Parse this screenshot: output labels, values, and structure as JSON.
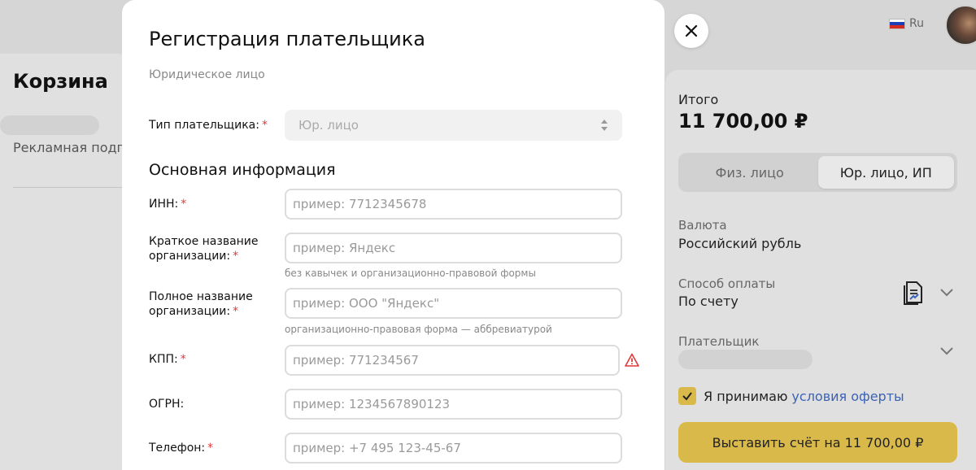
{
  "background": {
    "cart_title": "Корзина",
    "subscription_text": "Рекламная подпи",
    "language": "Ru"
  },
  "modal": {
    "title": "Регистрация плательщика",
    "subtitle": "Юридическое лицо",
    "payer_type": {
      "label": "Тип плательщика:",
      "value": "Юр. лицо"
    },
    "section_title": "Основная информация",
    "fields": {
      "inn": {
        "label": "ИНН:",
        "placeholder": "пример: 7712345678"
      },
      "short_name": {
        "label_line1": "Краткое название",
        "label_line2": "организации:",
        "placeholder": "пример: Яндекс",
        "hint": "без кавычек и организационно-правовой формы"
      },
      "full_name": {
        "label_line1": "Полное название",
        "label_line2": "организации:",
        "placeholder": "пример: ООО \"Яндекс\"",
        "hint": "организационно-правовая форма — аббревиатурой"
      },
      "kpp": {
        "label": "КПП:",
        "placeholder": "пример: 771234567"
      },
      "ogrn": {
        "label": "ОГРН:",
        "placeholder": "пример: 1234567890123"
      },
      "phone": {
        "label": "Телефон:",
        "placeholder": "пример: +7 495 123-45-67"
      }
    },
    "required_mark": "*"
  },
  "summary": {
    "total_label": "Итого",
    "total_value": "11 700,00 ₽",
    "switch": {
      "individual": "Физ. лицо",
      "legal": "Юр. лицо, ИП",
      "selected": "legal"
    },
    "currency_label": "Валюта",
    "currency_value": "Российский рубль",
    "payment_label": "Способ оплаты",
    "payment_value": "По счету",
    "payer_label": "Плательщик",
    "consent_text": "Я принимаю",
    "consent_link": "условия оферты",
    "pay_button": "Выставить счёт на 11 700,00 ₽"
  },
  "colors": {
    "accent_yellow": "#d9b94a",
    "link_blue": "#3a63b8",
    "required_red": "#e03a3a"
  }
}
